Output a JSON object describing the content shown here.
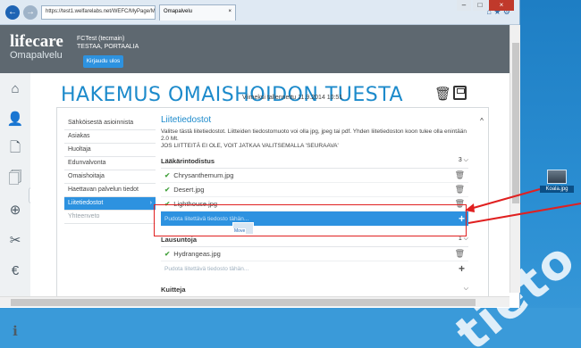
{
  "browser": {
    "address": "https://test1.welfarelabs.net/WEFC/MyPage/My/",
    "tab_title": "Omapalvelu"
  },
  "header": {
    "logo_main": "lifecare",
    "logo_sub": "Omapalvelu",
    "user_line1": "FCTest (tecmain)",
    "user_line2": "TESTAA, PORTAALIA",
    "logout_label": "Kirjaudu ulos"
  },
  "page": {
    "title": "HAKEMUS OMAISHOIDON TUESTA",
    "saved_text": "Viimeksi tallennettu 11.9.2014 10:51"
  },
  "steps": [
    {
      "label": "Sähköisestä asioinnista",
      "state": "normal"
    },
    {
      "label": "Asiakas",
      "state": "normal"
    },
    {
      "label": "Huoltaja",
      "state": "normal"
    },
    {
      "label": "Edunvalvonta",
      "state": "normal"
    },
    {
      "label": "Omaishoitaja",
      "state": "normal"
    },
    {
      "label": "Haettavan palvelun tiedot",
      "state": "normal"
    },
    {
      "label": "Liitetiedostot",
      "state": "active"
    },
    {
      "label": "Yhteenveto",
      "state": "dim"
    }
  ],
  "attachments": {
    "section_title": "Liitetiedostot",
    "info": "Valitse tästä liitetiedostot. Liitteiden tiedostomuoto voi olla jpg, jpeg tai pdf. Yhden liitetiedoston koon tulee olla enintään 2.0 Mt.",
    "info_caps": "JOS LIITTEITÄ EI OLE, VOIT JATKAA VALITSEMALLA 'SEURAAVA'",
    "group1": {
      "title": "Lääkärintodistus",
      "count": "3",
      "files": [
        "Chrysanthemum.jpg",
        "Desert.jpg",
        "Lighthouse.jpg"
      ],
      "drop_placeholder": "Pudota liitettävä tiedosto tähän..."
    },
    "group2": {
      "title": "Lausuntoja",
      "count": "1",
      "files": [
        "Hydrangeas.jpg"
      ],
      "drop_placeholder": "Pudota liitettävä tiedosto tähän..."
    },
    "group3_title": "Kuitteja"
  },
  "drag_ghost_label": "Move",
  "desktop": {
    "icon_label": "Koala.jpg",
    "watermark": "tieto"
  },
  "colors": {
    "accent": "#2d92e0",
    "title_blue": "#1c8acb",
    "header_gray": "#5e6870",
    "annotation_red": "#e02020"
  }
}
